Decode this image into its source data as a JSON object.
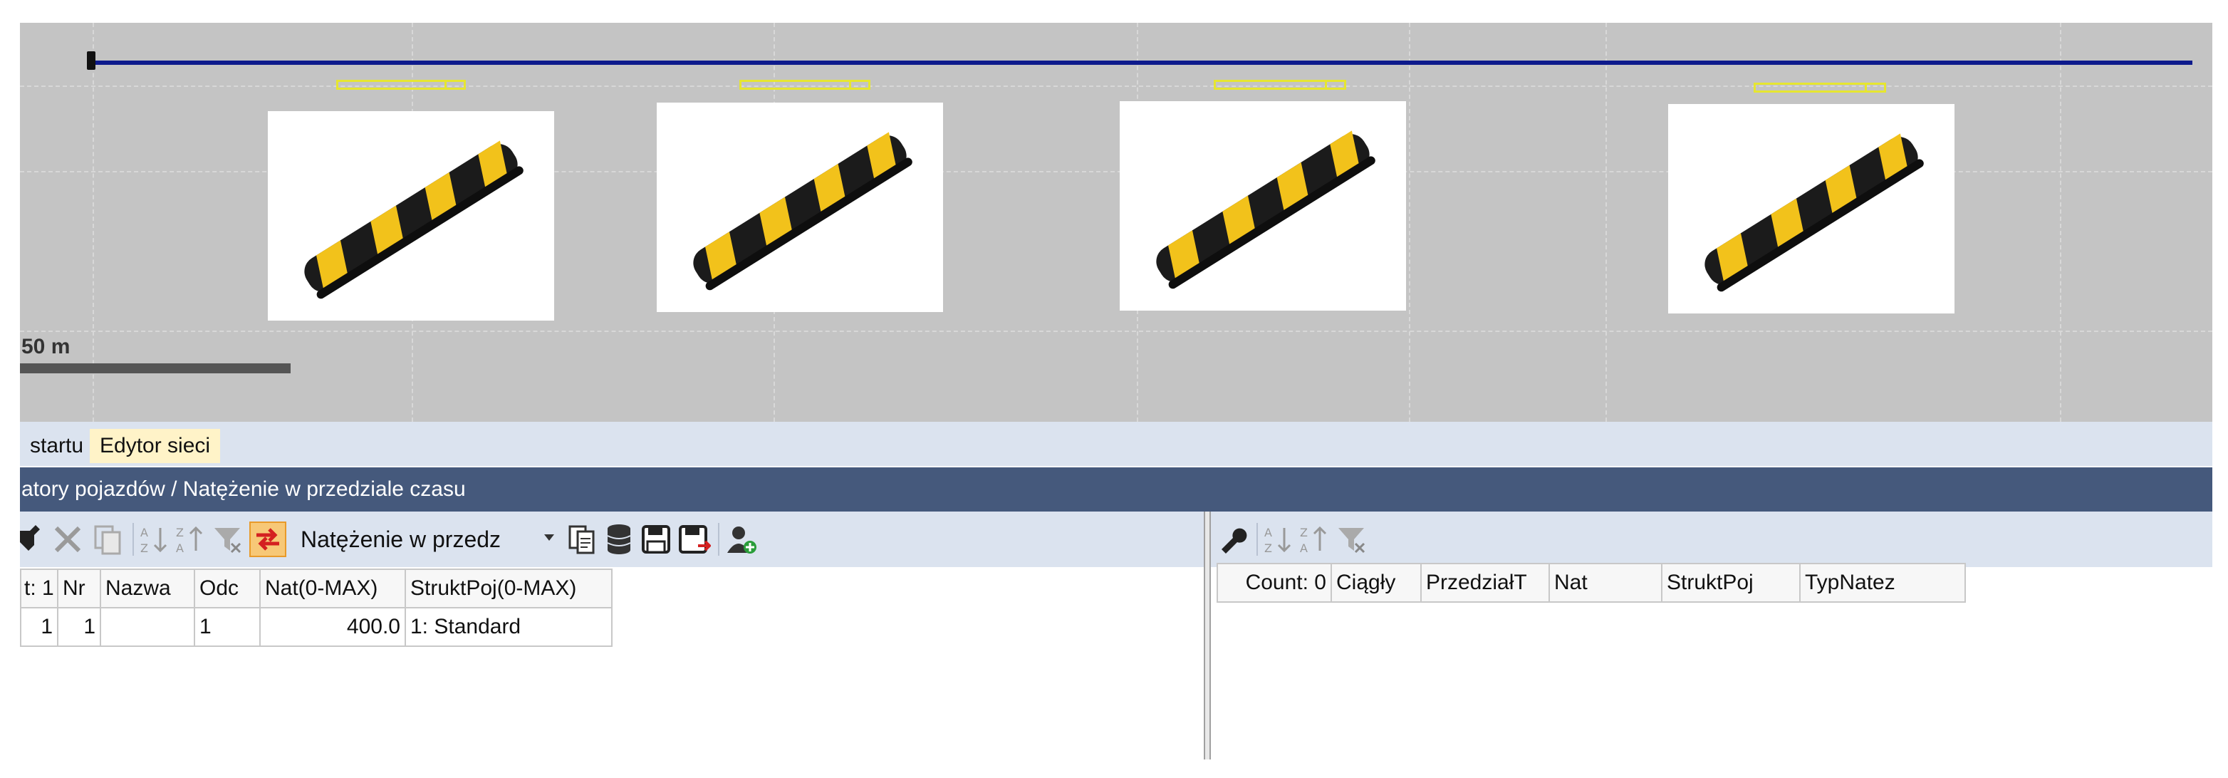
{
  "canvas": {
    "scale_label": "50 m",
    "background": "#c4c4c4",
    "road_color": "#0d1a8c",
    "detector_color": "#e6e630",
    "bump_images": [
      "speed-bump-image",
      "speed-bump-image",
      "speed-bump-image",
      "speed-bump-image"
    ]
  },
  "tabs": [
    {
      "label": "startu"
    },
    {
      "label": "Edytor sieci"
    }
  ],
  "title": "atory pojazdów / Natężenie w przedziale czasu",
  "left_toolbar": {
    "icons": [
      "wrench-icon",
      "delete-icon",
      "copy-icon",
      "sort-ascending-icon",
      "sort-descending-icon",
      "filter-clear-icon",
      "swap-icon"
    ],
    "combo_value": "Natężenie w przedz",
    "after_icons": [
      "copy-list-icon",
      "database-icon",
      "save-icon",
      "save-as-icon",
      "add-user-icon"
    ]
  },
  "left_table": {
    "columns": [
      "t: 1",
      "Nr",
      "Nazwa",
      "Odc",
      "Nat(0-MAX)",
      "StruktPoj(0-MAX)"
    ],
    "rows": [
      [
        "1",
        "1",
        "",
        "1",
        "400.0",
        "1: Standard"
      ]
    ]
  },
  "right_toolbar": {
    "icons": [
      "wrench-icon",
      "sort-ascending-icon",
      "sort-descending-icon",
      "filter-clear-icon"
    ]
  },
  "right_table": {
    "columns": [
      "Count: 0",
      "Ciągły",
      "PrzedziałT",
      "Nat",
      "StruktPoj",
      "TypNatez"
    ]
  }
}
